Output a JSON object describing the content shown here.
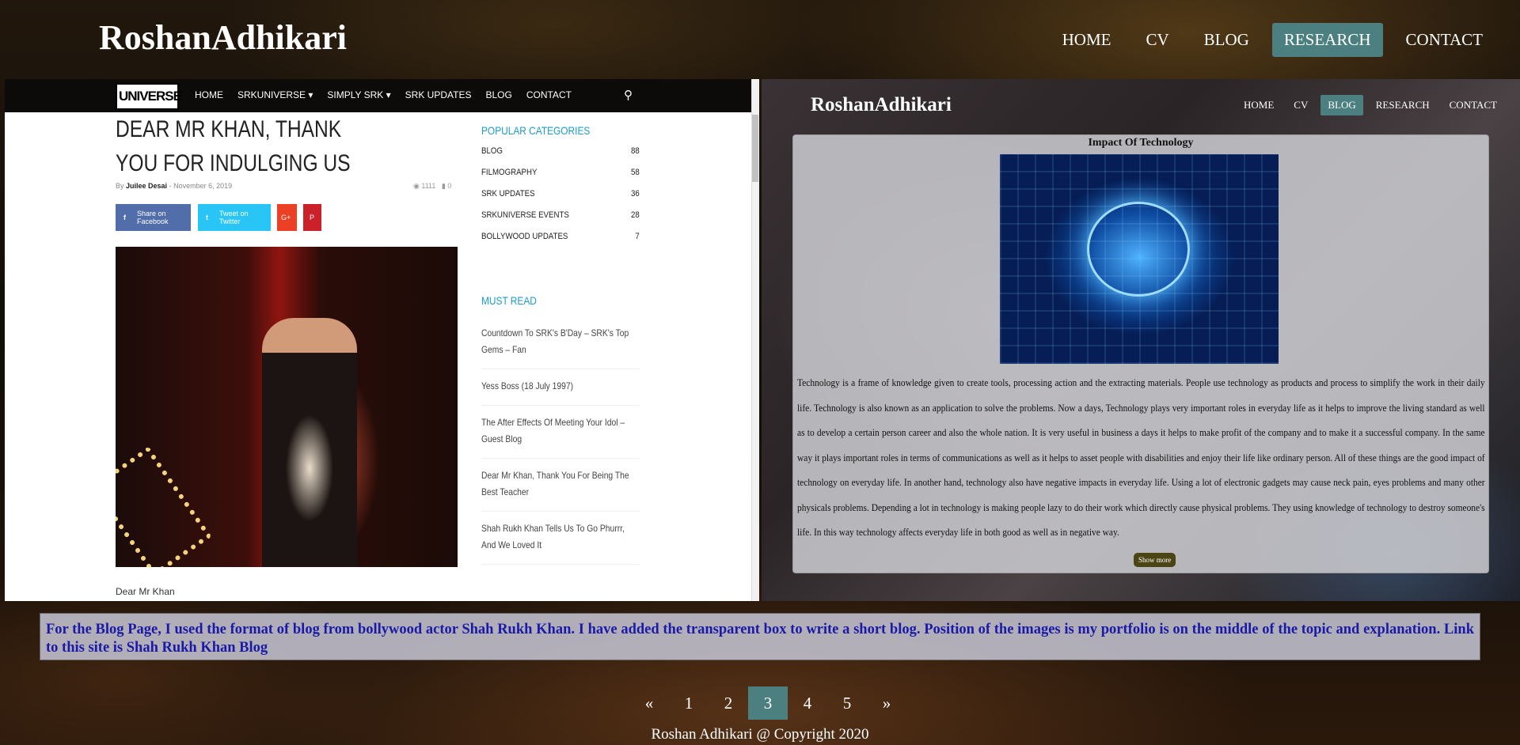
{
  "site": {
    "logo": "RoshanAdhikari",
    "nav": [
      "HOME",
      "CV",
      "BLOG",
      "RESEARCH",
      "CONTACT"
    ],
    "active_nav": "RESEARCH",
    "accent": "#4c7f80"
  },
  "left_shot": {
    "logo": "UNIVERSE",
    "menu": [
      "HOME",
      "SRKUNIVERSE ▾",
      "SIMPLY SRK ▾",
      "SRK UPDATES",
      "BLOG",
      "CONTACT"
    ],
    "title": "DEAR MR KHAN, THANK YOU FOR INDULGING US",
    "meta_by": "By",
    "meta_author": "Juilee Desai",
    "meta_date": "- November 6, 2019",
    "views": "1111",
    "comments": "0",
    "share_fb": "Share on Facebook",
    "share_tw": "Tweet on Twitter",
    "share_gp": "G+",
    "share_pin": "P",
    "caption": "Dear Mr Khan",
    "popular_heading": "POPULAR CATEGORIES",
    "categories": [
      {
        "name": "BLOG",
        "count": "88"
      },
      {
        "name": "FILMOGRAPHY",
        "count": "58"
      },
      {
        "name": "SRK UPDATES",
        "count": "36"
      },
      {
        "name": "SRKUNIVERSE EVENTS",
        "count": "28"
      },
      {
        "name": "BOLLYWOOD UPDATES",
        "count": "7"
      }
    ],
    "must_read_heading": "MUST READ",
    "must_read": [
      "Countdown To SRK's B'Day – SRK's Top Gems – Fan",
      "Yess Boss (18 July 1997)",
      "The After Effects Of Meeting Your Idol – Guest Blog",
      "Dear Mr Khan, Thank You For Being The Best Teacher",
      "Shah Rukh Khan Tells Us To Go Phurrr, And We Loved It"
    ]
  },
  "right_shot": {
    "logo": "RoshanAdhikari",
    "nav": [
      "HOME",
      "CV",
      "BLOG",
      "RESEARCH",
      "CONTACT"
    ],
    "active_nav": "BLOG",
    "box_title": "Impact Of Technology",
    "text": "Technology is a frame of knowledge given to create tools, processing action and the extracting materials. People use technology as products and process to simplify the work in their daily life. Technology is also known as an application to solve the problems. Now a days, Technology plays very important roles in everyday life as it helps to improve the living standard as well as to develop a certain person career and also the whole nation. It is very useful in business a days it helps to make profit of the company and to make it a successful company. In the same way it plays important roles in terms of communications as well as it helps to asset people with disabilities and enjoy their life like ordinary person. All of these things are the good impact of technology on everyday life. In another hand, technology also have negative impacts in everyday life. Using a lot of electronic gadgets may cause neck pain, eyes problems and many other physicals problems. Depending a lot in technology is making people lazy to do their work which directly cause physical problems. They using knowledge of technology to destroy someone's life. In this way technology affects everyday life in both good as well as in negative way.",
    "show_more": "Show more"
  },
  "description": {
    "text": "For the Blog Page, I used the format of blog from bollywood actor Shah Rukh Khan. I have added the transparent box to write a short blog. Position of the images is my portfolio is on the middle of the topic and explanation. Link to this site is ",
    "link": "Shah Rukh Khan Blog"
  },
  "pagination": {
    "prev": "«",
    "pages": [
      "1",
      "2",
      "3",
      "4",
      "5"
    ],
    "current": "3",
    "next": "»"
  },
  "footer": "Roshan Adhikari @ Copyright 2020"
}
